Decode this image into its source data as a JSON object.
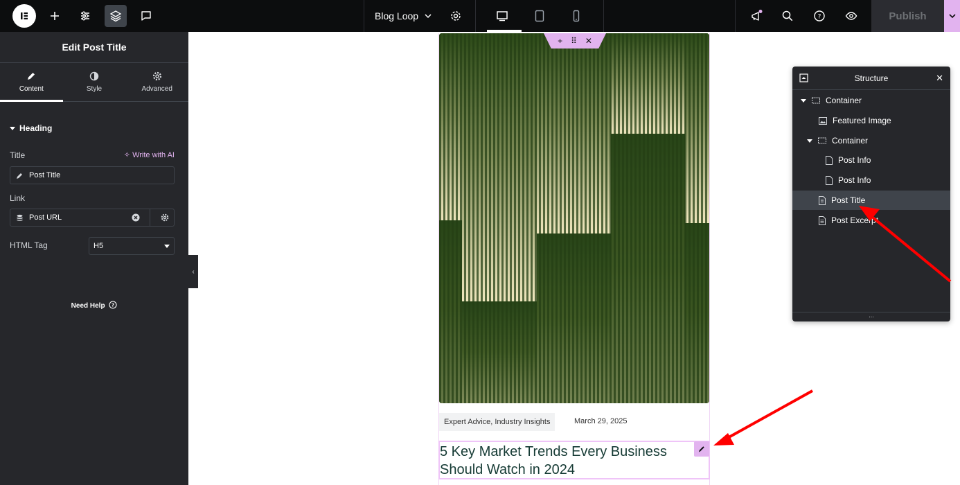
{
  "topbar": {
    "document_title": "Blog Loop",
    "publish_label": "Publish",
    "left_icons": [
      "elementor-logo-icon",
      "add-icon",
      "settings-sliders-icon",
      "layers-icon",
      "comments-icon"
    ],
    "device_icons": [
      "desktop-icon",
      "tablet-icon",
      "mobile-icon"
    ],
    "right_icons": [
      "whats-new-icon",
      "search-icon",
      "help-icon",
      "preview-icon"
    ]
  },
  "panel": {
    "title": "Edit Post Title",
    "tabs": [
      {
        "label": "Content",
        "icon": "pencil-icon",
        "active": true
      },
      {
        "label": "Style",
        "icon": "contrast-icon",
        "active": false
      },
      {
        "label": "Advanced",
        "icon": "gear-icon",
        "active": false
      }
    ],
    "section_heading": "Heading",
    "title_label": "Title",
    "write_ai_label": "Write with AI",
    "title_value": "Post Title",
    "link_label": "Link",
    "link_value": "Post URL",
    "html_tag_label": "HTML Tag",
    "html_tag_value": "H5",
    "need_help_label": "Need Help"
  },
  "canvas": {
    "categories": "Expert Advice, Industry Insights",
    "date": "March 29, 2025",
    "post_title": "5 Key Market Trends Every Business Should Watch in 2024"
  },
  "structure": {
    "title": "Structure",
    "items": [
      {
        "label": "Container",
        "icon": "container-icon"
      },
      {
        "label": "Featured Image",
        "icon": "image-icon"
      },
      {
        "label": "Container",
        "icon": "container-icon"
      },
      {
        "label": "Post Info",
        "icon": "post-info-icon"
      },
      {
        "label": "Post Info",
        "icon": "post-info-icon"
      },
      {
        "label": "Post Title",
        "icon": "post-title-icon",
        "selected": true
      },
      {
        "label": "Post Excerpt",
        "icon": "post-excerpt-icon"
      }
    ]
  },
  "colors": {
    "accent": "#e2b3ef",
    "panel_bg": "#26272b",
    "topbar_bg": "#0c0d0e",
    "annotation_arrow": "#ff0000"
  }
}
